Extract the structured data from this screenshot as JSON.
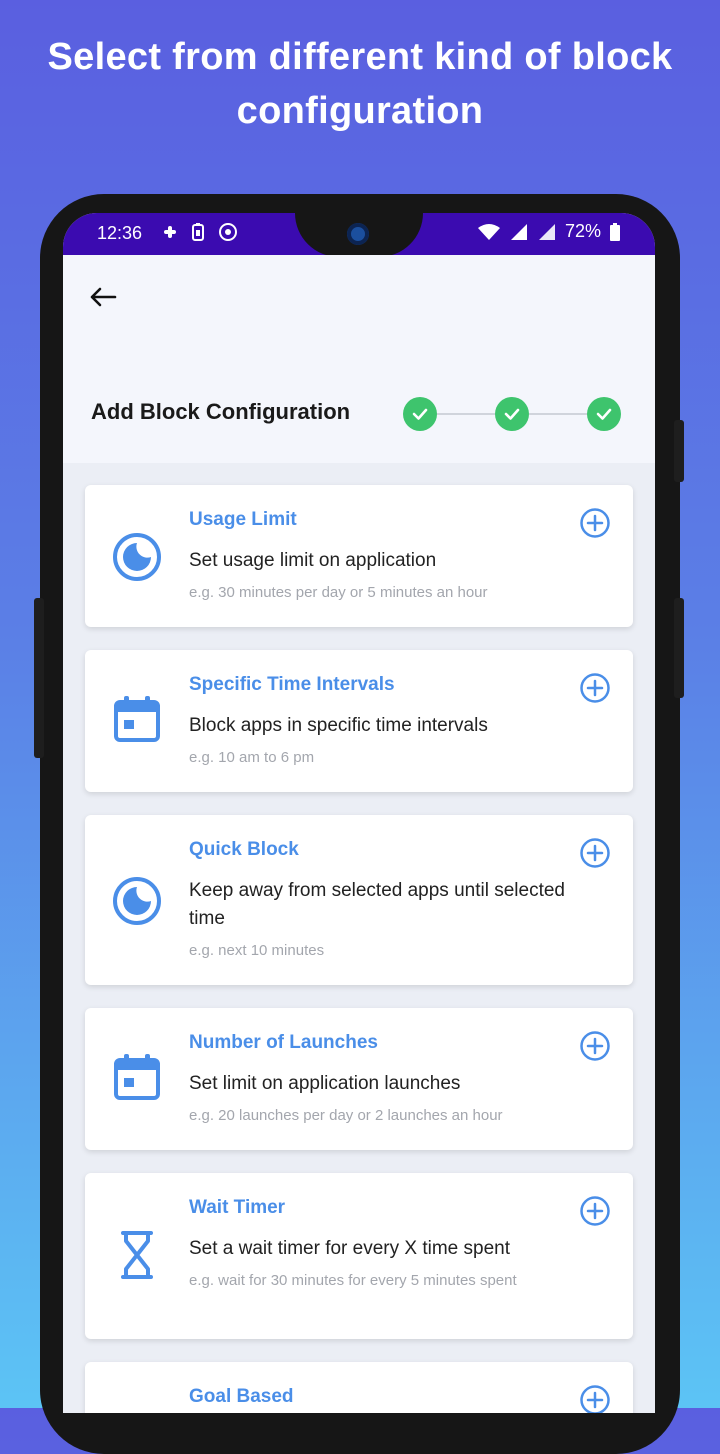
{
  "headline": "Select from different kind of block configuration",
  "status_bar": {
    "time": "12:36",
    "battery_text": "72%",
    "icons_left": [
      "slack-icon",
      "battery-saver-icon",
      "settings-app-icon"
    ],
    "icons_right": [
      "wifi-icon",
      "signal-icon",
      "signal-icon",
      "battery-icon"
    ]
  },
  "app_bar": {
    "back_icon": "arrow-left-icon",
    "title": "Add Block Configuration",
    "steps": [
      {
        "state": "done"
      },
      {
        "state": "done"
      },
      {
        "state": "done"
      }
    ]
  },
  "cards": [
    {
      "title": "Usage Limit",
      "description": "Set usage limit on application",
      "example": "e.g. 30 minutes per day or 5 minutes an hour",
      "icon": "clock-moon-icon"
    },
    {
      "title": "Specific Time Intervals",
      "description": "Block apps in specific time intervals",
      "example": "e.g. 10 am to 6 pm",
      "icon": "calendar-icon"
    },
    {
      "title": "Quick Block",
      "description": "Keep away from selected apps until selected time",
      "example": "e.g. next 10 minutes",
      "icon": "clock-moon-icon"
    },
    {
      "title": "Number of Launches",
      "description": "Set limit on application launches",
      "example": "e.g. 20 launches per day or 2 launches an hour",
      "icon": "calendar-icon"
    },
    {
      "title": "Wait Timer",
      "description": "Set a wait timer for every X time spent",
      "example": "e.g. wait for 30 minutes for every 5 minutes spent",
      "icon": "hourglass-icon"
    },
    {
      "title": "Goal Based",
      "description": "",
      "example": "",
      "icon": ""
    }
  ],
  "colors": {
    "accent": "#4a8ee8",
    "step_done": "#3ec46d",
    "status_bar": "#3b0bb0",
    "gradient_top": "#5a5fe0",
    "gradient_bottom": "#5cc4f5"
  }
}
